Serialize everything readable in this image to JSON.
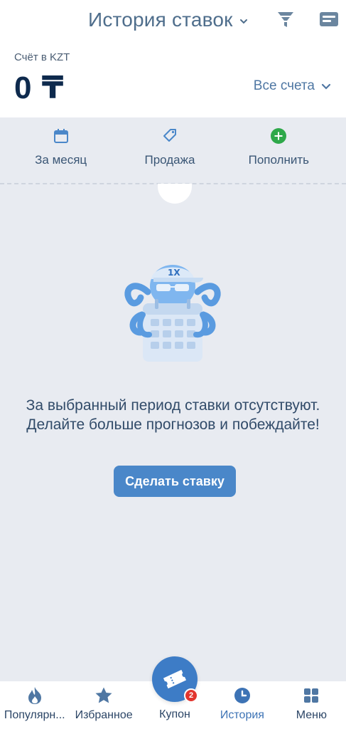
{
  "header": {
    "title": "История ставок",
    "account_label": "Счёт в KZT",
    "balance": "0 ₸",
    "accounts_selector": "Все счета"
  },
  "quick_actions": [
    {
      "label": "За месяц",
      "icon": "calendar-icon"
    },
    {
      "label": "Продажа",
      "icon": "tag-icon"
    },
    {
      "label": "Пополнить",
      "icon": "plus-circle-icon"
    }
  ],
  "empty_state": {
    "message": "За выбранный период ставки отсутствуют. Делайте больше прогнозов и побеждайте!",
    "button_label": "Сделать ставку"
  },
  "bottom_nav": {
    "items": [
      {
        "label": "Популярн...",
        "icon": "flame-icon"
      },
      {
        "label": "Избранное",
        "icon": "star-icon"
      },
      {
        "label": "Купон",
        "icon": "ticket-icon",
        "badge": "2"
      },
      {
        "label": "История",
        "icon": "clock-icon",
        "active": true
      },
      {
        "label": "Меню",
        "icon": "grid-icon"
      }
    ]
  },
  "colors": {
    "accent": "#4a87c9",
    "active_nav": "#3d73b5",
    "add_green": "#2ea84a",
    "badge_red": "#e2352e",
    "background": "#e8ebf1"
  }
}
